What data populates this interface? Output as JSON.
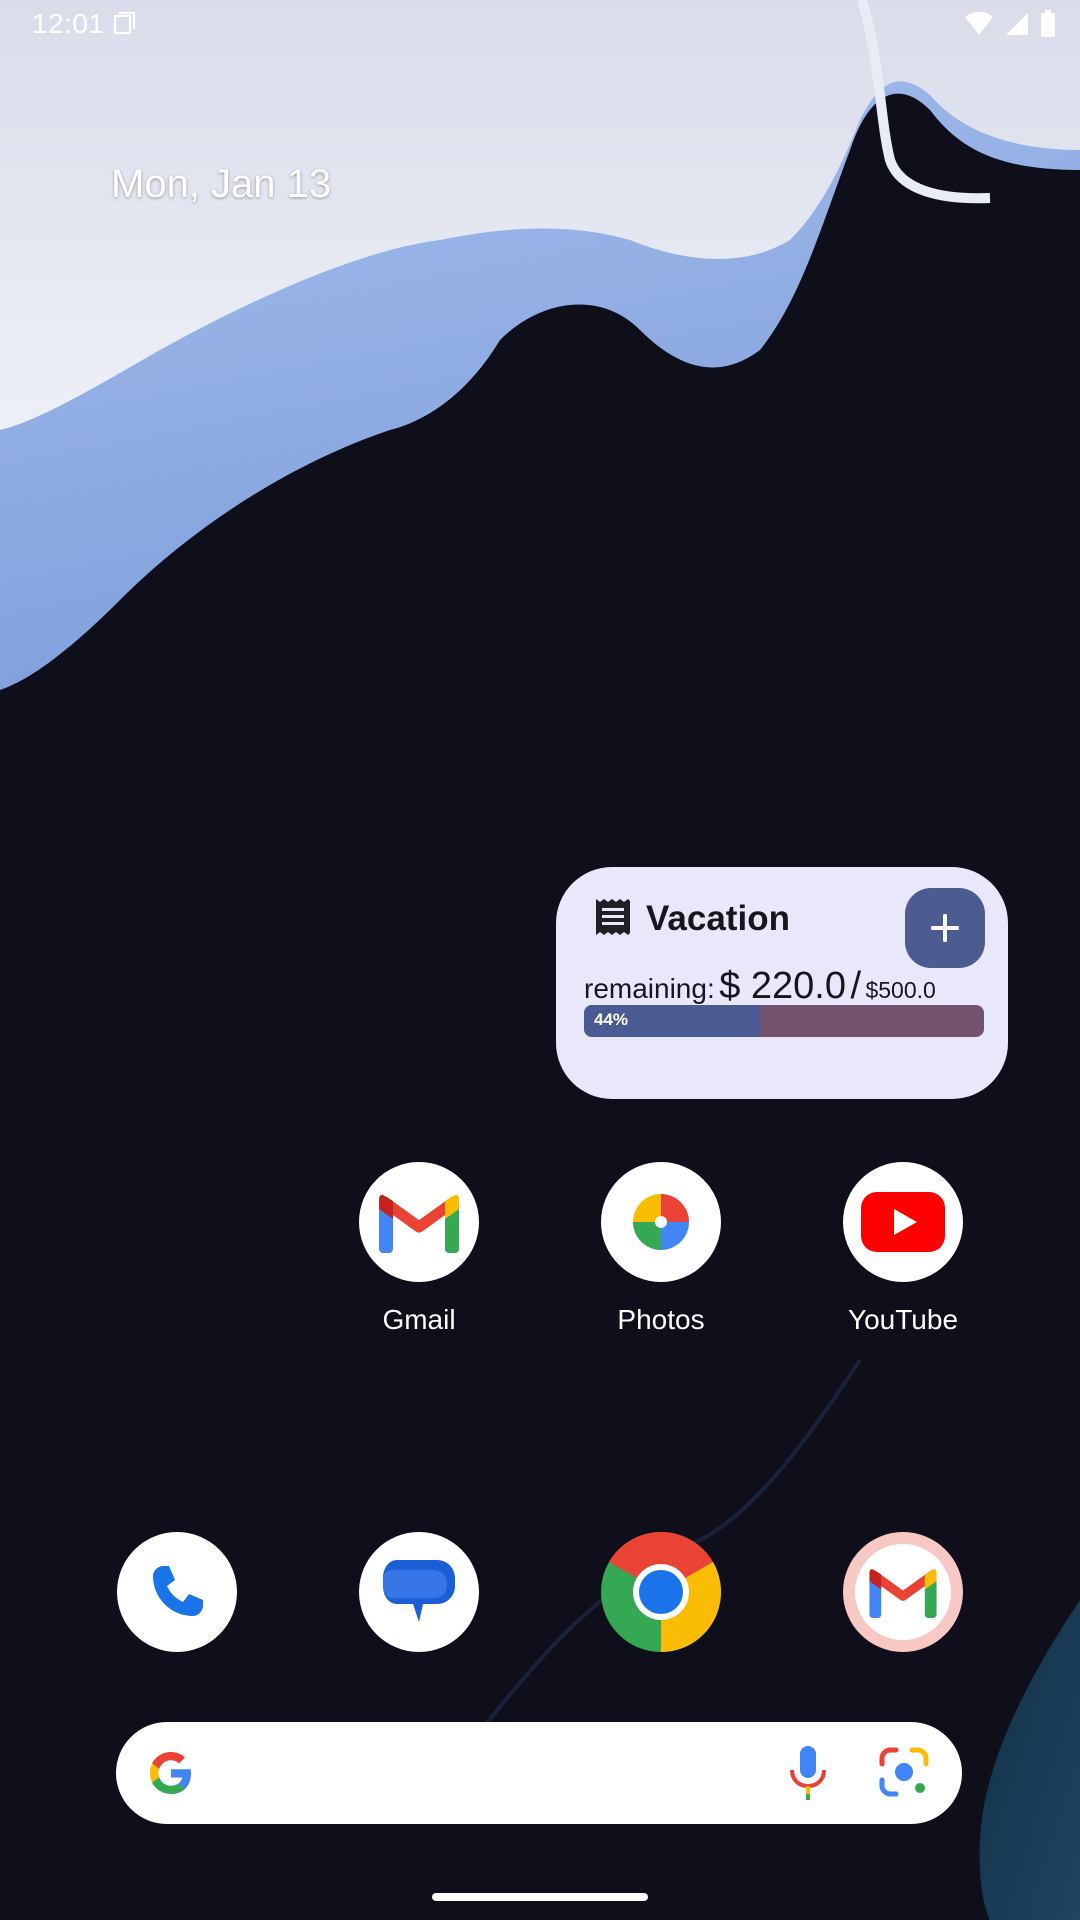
{
  "status_bar": {
    "time": "12:01",
    "icons": [
      "screenshot-icon",
      "wifi-icon",
      "cell-signal-icon",
      "battery-icon"
    ]
  },
  "home": {
    "date": "Mon, Jan 13"
  },
  "widget": {
    "title": "Vacation",
    "remaining_label": "remaining:",
    "remaining_amount": "$ 220.0",
    "separator": "/",
    "total_amount": "$500.0",
    "progress_label": "44%",
    "progress_fraction": 0.44,
    "colors": {
      "background": "#e9e8fa",
      "accent": "#4c5b90",
      "progress_fill": "#4a5a92",
      "progress_track": "#74536f"
    },
    "icons": [
      "receipt-icon",
      "plus-icon"
    ]
  },
  "apps_row": [
    {
      "label": "Gmail",
      "icon": "gmail-icon"
    },
    {
      "label": "Photos",
      "icon": "photos-icon"
    },
    {
      "label": "YouTube",
      "icon": "youtube-icon"
    }
  ],
  "dock": [
    {
      "icon": "phone-icon"
    },
    {
      "icon": "messages-icon"
    },
    {
      "icon": "chrome-icon"
    },
    {
      "icon": "gmail-icon"
    }
  ],
  "search_bar": {
    "icons": [
      "google-g-icon",
      "microphone-icon",
      "google-lens-icon"
    ]
  }
}
